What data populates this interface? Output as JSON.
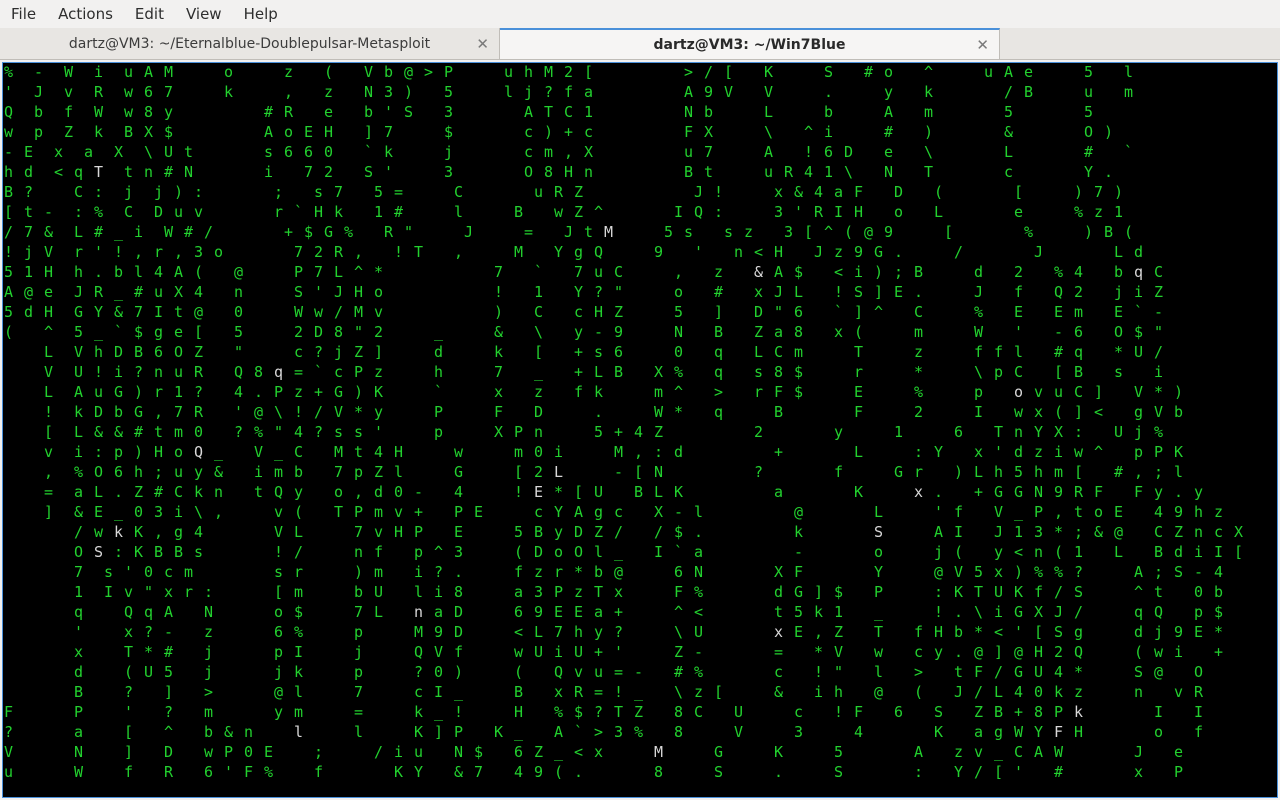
{
  "menu": [
    "File",
    "Actions",
    "Edit",
    "View",
    "Help"
  ],
  "tabs": [
    {
      "label": "dartz@VM3: ~/Eternalblue-Doublepulsar-Metasploit",
      "active": false
    },
    {
      "label": "dartz@VM3: ~/Win7Blue",
      "active": true
    }
  ],
  "icons": {
    "tab_close": "close-icon"
  },
  "colors": {
    "matrix_green": "#22d12e",
    "matrix_white": "#d8d8d8",
    "background": "#000000",
    "accent": "#4a90d9"
  },
  "terminal": {
    "rows": [
      "%  -  W  i  u A M     o     z   (   V b @ > P     u h M 2 [         > / [   K     S   # o   ^     u A e     5   l",
      "'  J  v  R  w 6 7     k     ,   z   N 3 )   5     l j ? f a         A 9 V   V     .     y   k       / B     u   m",
      "Q  b  f  W  w 8 y         # R   e   b ' S   3       A T C 1         N b     L     b     A   m       5       5    ",
      "w  p  Z  k  B X $         A o E H   ] 7     $       c ) + c         F X     \\   ^ i     #   )       &       O )  ",
      "- E  x  a  X  \\ U t       s 6 6 0   ` k     j       c m , X         u 7     A   ! 6 D   e   \\       L       #   `",
      "h d  < q T  t n # N       i   7 2   S '     3       O 8 H n         B t     u R 4 1 \\   N   T       c       Y .  ",
      "B ?    C :  j  j ) :       ;   s 7   5 =     C       u R Z           J !     x & 4 a F   D   (       [     ) 7 )  ",
      "[ t -  : %  C  D u v       r ` H k   1 #     l     B   w Z ^       I Q :     3 ' R I H   o   L       e     % z 1  ",
      "/ 7 &  L # _ i  W # /       + $ G %   R \"     J     =   J t M     5 s   s z   3 [ ^ ( @ 9     [       %     ) B (",
      "! j V  r ' ! , r , 3 o       7 2 R ,   ! T   ,     M   Y g Q     9   '   n < H   J z 9 G .     /       J       L d",
      "5 1 H  h . b l 4 A (   @     P 7 L ^ *           7   `   7 u C     ,   z   & A $   < i ) ; B     d   2   % 4   b q C",
      "A @ e  J R _ # u X 4   n     S ' J H o           !   1   Y ? \"     o   #   x J L   ! S ] E .     J   f   Q 2   j i Z",
      "5 d H  G Y & 7 I t @   0     W w / M v           )   C   c H Z     5   ]   D \" 6   ` ] ^   C     %   E   E m   E ` -",
      "(   ^  5 _ ` $ g e [   5     2 D 8 \" 2     _     &   \\   y - 9     N   B   Z a 8   x (     m     W   '   - 6   O $ \"",
      "    L  V h D B 6 O Z   \"     c ? j Z ]     d     k   [   + s 6     0   q   L C m     T     z     f f l   # q   * U /",
      "    V  U ! i ? n u R   Q 8 q = ` c P z     h     7   _   + L B   X %   q   s 8 $     r     *     \\ p C   [ B   s   i",
      "    L  A u G ) r 1 ?   4 . P z + G ) K     `     x   z   f k     m ^   >   r F $     E     %     p   o v u C ]   V * )",
      "    !  k D b G , 7 R   ' @ \\ ! / V * y     P     F   D     .     W *   q     B       F     2     I   w x ( ] <   g V b",
      "    [  L & & # t m 0   ? % \" 4 ? s s '     p     X P n     5 + 4 Z         2       y     1     6   T n Y X :   U j %",
      "    v  i : p ) H o Q _   V _ C   M t 4 H     w     m 0 i     M , : d         +       L     : Y   x ' d z i w ^   p P K",
      "    ,  % O 6 h ; u y &   i m b   7 p Z l     G     [ 2 L     - [ N         ?       f     G r   ) L h 5 h m [   # , ; l",
      "    =  a L . Z # C k n   t Q y   o , d 0 -   4     ! E * [ U   B L K         a       K     x .   + G G N 9 R F   F y . y",
      "    ]  & E _ 0 3 i \\ ,     v (   T P m v +   P E     c Y A g c   X - l         @       L     ' f   V _ P , t o E   4 9 h z",
      "       / w k K , g 4       V L     7 v H P   E     5 B y D Z /   / $ .         k       S     A I   J 1 3 * ; & @   C Z n c X",
      "       O S : K B B s       ! /     n f   p ^ 3     ( D o O l _   I ` a         -       o     j (   y < n ( 1   L   B d i I [",
      "       7  s ' 0 c m        s r     ) m   i ? .     f z r * b @     6 N       X F       Y     @ V 5 x ) % % ?     A ; S - 4",
      "       1  I v \" x r :      [ m     b U   l i 8     a 3 P z T x     F %       d G ] $   P     : K T U K f / S     ^ t   0 b",
      "       q    Q q A   N      o $     7 L   n a D     6 9 E E a +     ^ <       t 5 k 1   _     ! . \\ i G X J /     q Q   p $",
      "       '    x ? -   z      6 %     p     M 9 D     < L 7 h y ?     \\ U       x E , Z   T   f H b * < ' [ S g     d j 9 E *",
      "       x    T * #   j      p I     j     Q V f     w U i U + '     Z -       =   * V   w   c y . @ ] @ H 2 Q     ( w i   +",
      "       d    ( U 5   j      j k     p     ? 0 )     (   Q v u = -   # %       c   ! \"   l   >   t F / G U 4 *     S @   O",
      "       B    ?   ]   >      @ l     7     c I _     B   x R = ! _   \\ z [     &   i h   @   (   J / L 4 0 k z     n   v R",
      "F      P    '   ?   m      y m     =     k _ !     H   % $ ? T Z   8 C   U     c   ! F   6   S   Z B + 8 P k       I   I",
      "?      a    [   ^   b & n    l     l     K ] P   K _   A ` > 3 %   8     V     3     4       K   a g W Y F H       o   f",
      "V      N    ]   D   w P 0 E    ;     / i u   N $   6 Z _ < x     M     G     K     5       A   z v _ C A W       J   e",
      "u      W    f   R   6 ' F %    f       K Y   & 7   4 9 ( .       8     S     .     S       :   Y / [ '   #       x   P"
    ]
  }
}
